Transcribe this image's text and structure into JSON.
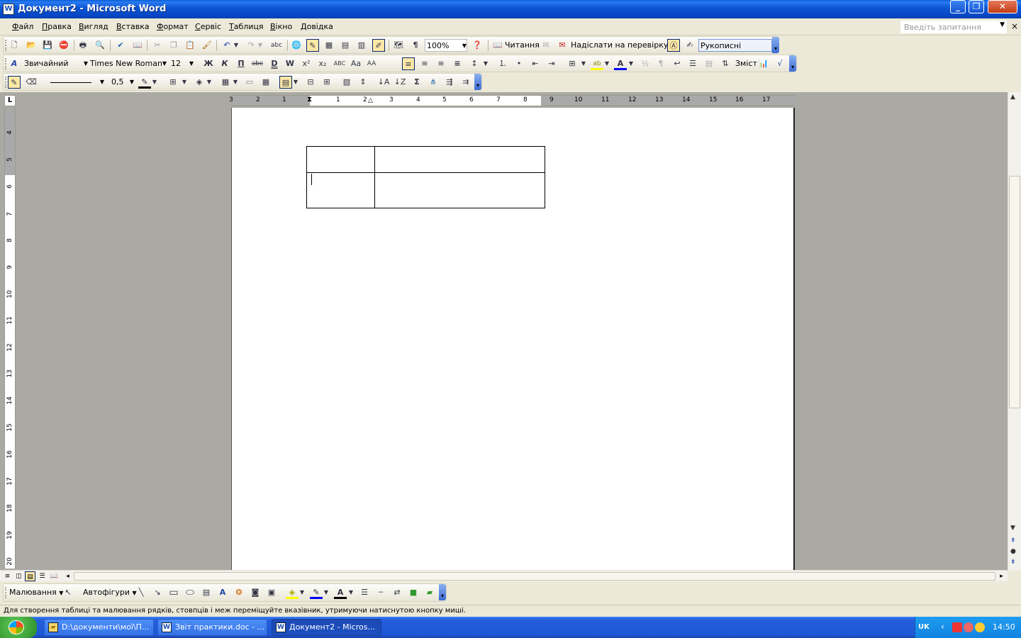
{
  "window": {
    "title": "Документ2 - Microsoft Word",
    "app_icon": "W",
    "controls": {
      "minimize": "_",
      "maximize": "❐",
      "close": "✕"
    }
  },
  "menu": {
    "items": [
      "Файл",
      "Правка",
      "Вигляд",
      "Вставка",
      "Формат",
      "Сервіс",
      "Таблиця",
      "Вікно",
      "Довідка"
    ],
    "help_placeholder": "Введіть запитання",
    "close_doc": "×"
  },
  "standard_toolbar": {
    "zoom": "100%",
    "reading_label": "Читання",
    "send_review_label": "Надіслати на перевірку...",
    "ink_annotations_label": "Рукописні примітки"
  },
  "formatting_toolbar": {
    "style": "Звичайний",
    "font": "Times New Roman",
    "size": "12",
    "bold": "Ж",
    "italic": "К",
    "underline": "П",
    "strike": "abc",
    "contents_label": "Зміст"
  },
  "tables_toolbar": {
    "line_weight": "0,5"
  },
  "ruler": {
    "h_numbers": [
      "3",
      "2",
      "1",
      "1",
      "2",
      "3",
      "4",
      "5",
      "6",
      "7",
      "8",
      "9",
      "10",
      "11",
      "12",
      "13",
      "14",
      "15",
      "16",
      "17"
    ],
    "v_numbers": [
      "4",
      "5",
      "6",
      "7",
      "8",
      "9",
      "10",
      "11",
      "12",
      "13",
      "14",
      "15",
      "16",
      "17",
      "18",
      "19",
      "20"
    ],
    "corner": "L"
  },
  "drawing_toolbar": {
    "drawing_label": "Малювання",
    "autoshapes_label": "Автофігури"
  },
  "status_bar": {
    "text": "Для створення таблиці та малювання рядків, стовпців і меж переміщуйте вказівник, утримуючи натиснутою кнопку миші."
  },
  "taskbar": {
    "tasks": [
      {
        "label": "D:\\документи\\мої\\П...",
        "icon": "folder-icon"
      },
      {
        "label": "Звіт практики.doc - ...",
        "icon": "word-icon"
      },
      {
        "label": "Документ2 - Micros...",
        "icon": "word-icon"
      }
    ],
    "language": "UK",
    "clock": "14:50"
  },
  "colors": {
    "titlebar": "#0c58d6",
    "workspace": "#aaa9a4",
    "page": "#ffffff"
  }
}
